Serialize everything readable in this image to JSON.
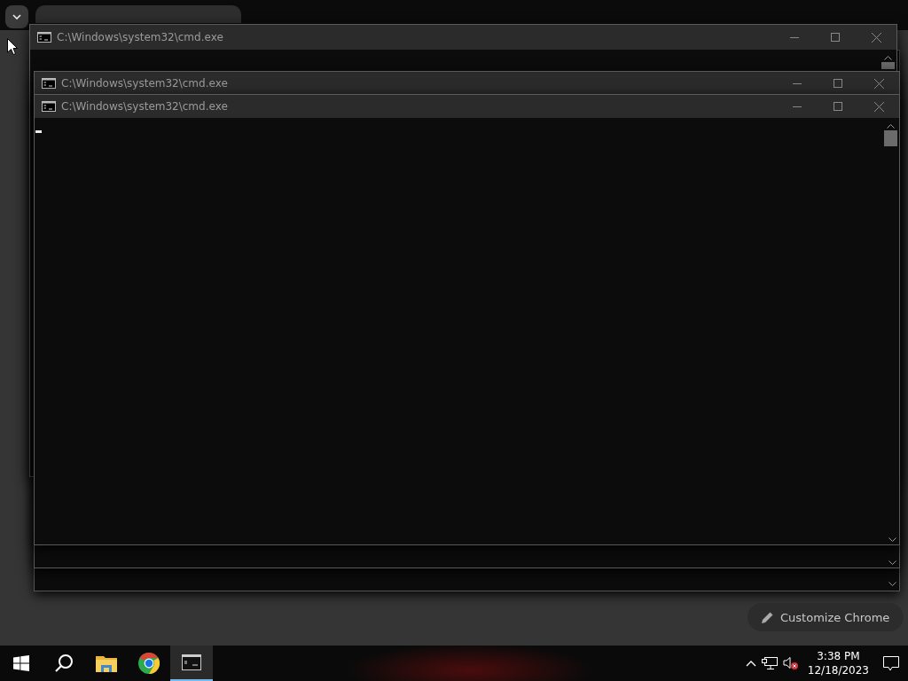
{
  "browser": {
    "customize_button": "Customize Chrome"
  },
  "windows": [
    {
      "title": "C:\\Windows\\system32\\cmd.exe"
    },
    {
      "title": "C:\\Windows\\system32\\cmd.exe"
    },
    {
      "title": "C:\\Windows\\system32\\cmd.exe"
    }
  ],
  "taskbar": {
    "apps": [
      {
        "kind": "start",
        "active": false
      },
      {
        "kind": "search",
        "active": false
      },
      {
        "kind": "explorer",
        "active": false
      },
      {
        "kind": "chrome",
        "active": false
      },
      {
        "kind": "terminal",
        "active": true
      }
    ],
    "clock": {
      "time": "3:38 PM",
      "date": "12/18/2023"
    }
  }
}
